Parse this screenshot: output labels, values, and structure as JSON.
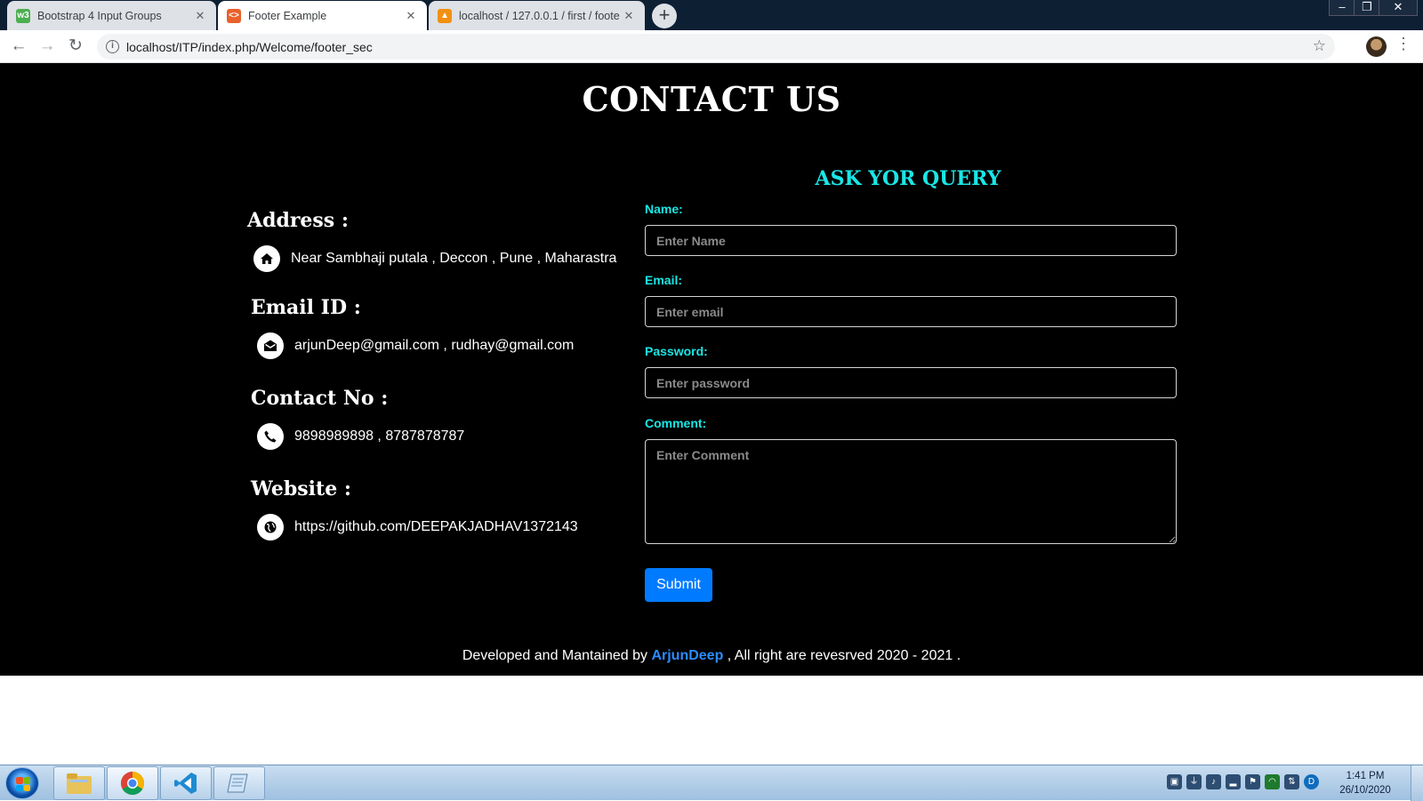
{
  "browser": {
    "tabs": [
      {
        "title": "Bootstrap 4 Input Groups",
        "favicon": "w3-icon",
        "active": false
      },
      {
        "title": "Footer Example",
        "favicon": "html-icon",
        "active": true
      },
      {
        "title": "localhost / 127.0.0.1 / first / foote",
        "favicon": "phpmyadmin-icon",
        "active": false
      }
    ],
    "new_tab_label": "+",
    "url": "localhost/ITP/index.php/Welcome/footer_sec"
  },
  "page": {
    "title": "CONTACT US",
    "address": {
      "heading": "Address :",
      "value": "Near Sambhaji putala , Deccon , Pune , Maharastra",
      "icon": "home-icon"
    },
    "email": {
      "heading": "Email ID :",
      "value": "arjunDeep@gmail.com , rudhay@gmail.com",
      "icon": "envelope-icon"
    },
    "contact": {
      "heading": "Contact No :",
      "value": "9898989898 , 8787878787",
      "icon": "phone-icon"
    },
    "website": {
      "heading": "Website :",
      "value": "https://github.com/DEEPAKJADHAV1372143",
      "icon": "globe-icon"
    },
    "form": {
      "title": "ASK YOR QUERY",
      "name_label": "Name:",
      "name_placeholder": "Enter Name",
      "email_label": "Email:",
      "email_placeholder": "Enter email",
      "password_label": "Password:",
      "password_placeholder": "Enter password",
      "comment_label": "Comment:",
      "comment_placeholder": "Enter Comment",
      "submit_label": "Submit"
    },
    "footer": {
      "prefix": "Developed and Mantained by",
      "author": "ArjunDeep",
      "suffix": ", All right are revesrved 2020 - 2021 ."
    }
  },
  "taskbar": {
    "pinned": [
      "explorer-icon",
      "chrome-icon",
      "vscode-icon",
      "notepad-icon"
    ],
    "time": "1:41 PM",
    "date": "26/10/2020"
  },
  "colors": {
    "accent_cyan": "#1ae6e6",
    "submit_blue": "#007bff",
    "author_link": "#2a8cff",
    "page_bg": "#000000"
  }
}
